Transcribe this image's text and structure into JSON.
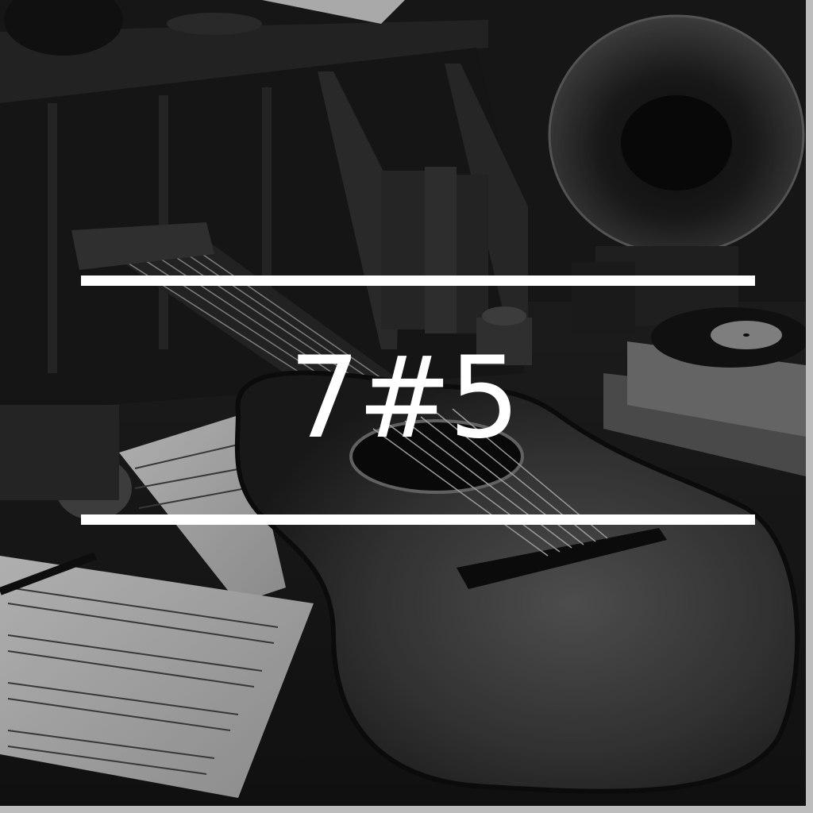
{
  "overlay": {
    "chord_label": "7#5",
    "text_color": "#ffffff",
    "line_color": "#ffffff"
  },
  "photo": {
    "tone": "black-and-white",
    "base_color": "#161616"
  }
}
